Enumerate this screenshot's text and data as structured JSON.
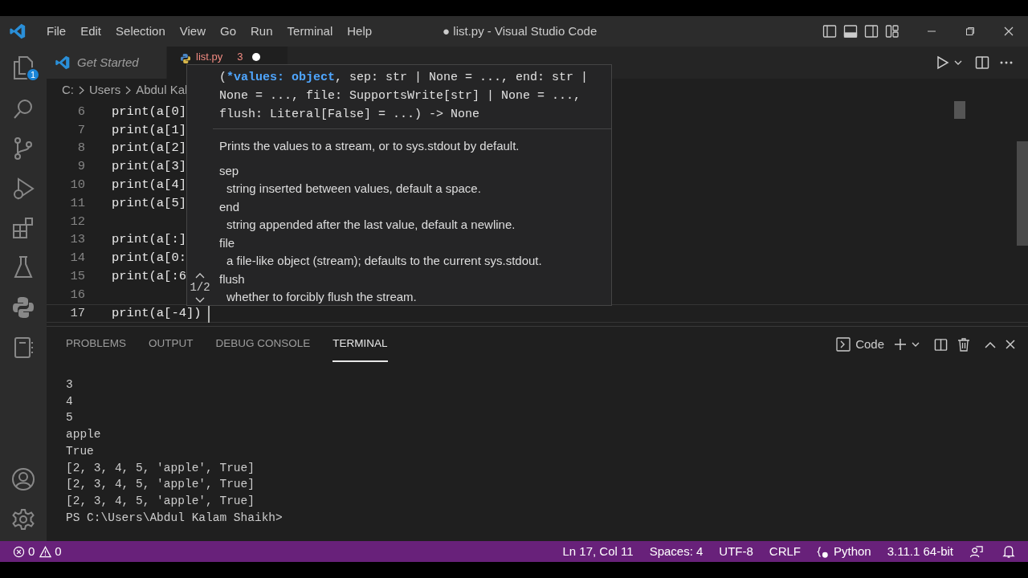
{
  "menu": [
    "File",
    "Edit",
    "Selection",
    "View",
    "Go",
    "Run",
    "Terminal",
    "Help"
  ],
  "window": {
    "title": "● list.py - Visual Studio Code"
  },
  "activity_bar": {
    "explorer_badge": "1"
  },
  "tabs": [
    {
      "label": "Get Started",
      "selected": false,
      "kind": "welcome"
    },
    {
      "label": "list.py",
      "selected": true,
      "kind": "python",
      "problems": "3",
      "dirty": true
    }
  ],
  "breadcrumb": [
    "C:",
    "Users",
    "Abdul Kal"
  ],
  "editor": {
    "lines": [
      {
        "number": "6",
        "code": "print(a[0]",
        "current": false
      },
      {
        "number": "7",
        "code": "print(a[1]",
        "current": false
      },
      {
        "number": "8",
        "code": "print(a[2]",
        "current": false
      },
      {
        "number": "9",
        "code": "print(a[3]",
        "current": false
      },
      {
        "number": "10",
        "code": "print(a[4]",
        "current": false
      },
      {
        "number": "11",
        "code": "print(a[5]",
        "current": false
      },
      {
        "number": "12",
        "current": false
      },
      {
        "number": "13",
        "code": "print(a[:]",
        "current": false
      },
      {
        "number": "14",
        "code": "print(a[0:",
        "current": false
      },
      {
        "number": "15",
        "code": "print(a[:6",
        "current": false
      },
      {
        "number": "16",
        "current": false
      },
      {
        "number": "17",
        "code": "print(a[-4])",
        "current": true
      }
    ]
  },
  "hover": {
    "overload": "1/2",
    "signature": [
      {
        "text": "(",
        "active": false
      },
      {
        "text": "*values: object",
        "active": true
      },
      {
        "text": ", sep: str | None = ..., end: str | None = ..., file: SupportsWrite[str] | None = ..., flush: Literal[False] = ...) -> None",
        "active": false
      }
    ],
    "summary": "Prints the values to a stream, or to sys.stdout by default.",
    "params": [
      {
        "name": "sep",
        "description": "string inserted between values, default a space."
      },
      {
        "name": "end",
        "description": "string appended after the last value, default a newline."
      },
      {
        "name": "file",
        "description": "a file-like object (stream); defaults to the current sys.stdout."
      },
      {
        "name": "flush",
        "description": "whether to forcibly flush the stream."
      }
    ]
  },
  "panel": {
    "tabs": [
      {
        "label": "PROBLEMS",
        "selected": false
      },
      {
        "label": "OUTPUT",
        "selected": false
      },
      {
        "label": "DEBUG CONSOLE",
        "selected": false
      },
      {
        "label": "TERMINAL",
        "selected": true
      }
    ],
    "terminal_name": "Code",
    "terminal_lines": [
      "3",
      "4",
      "5",
      "apple",
      "True",
      "[2, 3, 4, 5, 'apple', True]",
      "[2, 3, 4, 5, 'apple', True]",
      "[2, 3, 4, 5, 'apple', True]",
      "PS C:\\Users\\Abdul Kalam Shaikh>"
    ]
  },
  "status_bar": {
    "errors": "0",
    "warnings": "0",
    "items": [
      "Ln 17, Col 11",
      "Spaces: 4",
      "UTF-8",
      "CRLF",
      "Python",
      "3.11.1 64-bit"
    ]
  }
}
